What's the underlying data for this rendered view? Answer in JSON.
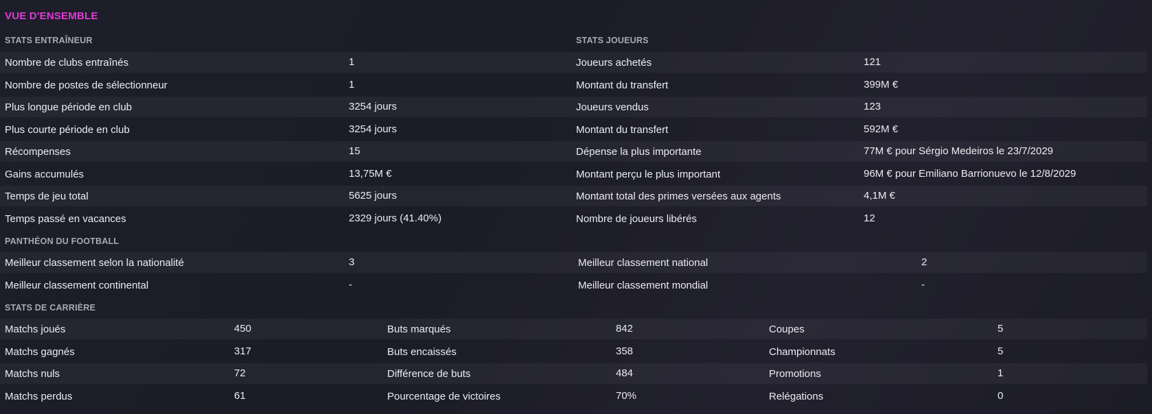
{
  "title": "VUE D'ENSEMBLE",
  "coach_stats": {
    "header": "STATS ENTRAÎNEUR",
    "rows": [
      {
        "label": "Nombre de clubs entraînés",
        "value": "1"
      },
      {
        "label": "Nombre de postes de sélectionneur",
        "value": "1"
      },
      {
        "label": "Plus longue période en club",
        "value": "3254 jours"
      },
      {
        "label": "Plus courte période en club",
        "value": "3254 jours"
      },
      {
        "label": "Récompenses",
        "value": "15"
      },
      {
        "label": "Gains accumulés",
        "value": "13,75M €"
      },
      {
        "label": "Temps de jeu total",
        "value": "5625 jours"
      },
      {
        "label": "Temps passé en vacances",
        "value": "2329 jours (41.40%)"
      }
    ]
  },
  "player_stats": {
    "header": "STATS JOUEURS",
    "rows": [
      {
        "label": "Joueurs achetés",
        "value": "121"
      },
      {
        "label": "Montant du transfert",
        "value": "399M €"
      },
      {
        "label": "Joueurs vendus",
        "value": "123"
      },
      {
        "label": "Montant du transfert",
        "value": "592M €"
      },
      {
        "label": "Dépense la plus importante",
        "value": "77M € pour Sérgio Medeiros le 23/7/2029"
      },
      {
        "label": "Montant perçu le plus important",
        "value": "96M € pour Emiliano Barrionuevo le 12/8/2029"
      },
      {
        "label": "Montant total des primes versées aux agents",
        "value": "4,1M €"
      },
      {
        "label": "Nombre de joueurs libérés",
        "value": "12"
      }
    ]
  },
  "hall_of_fame": {
    "header": "PANTHÉON DU FOOTBALL",
    "rows": [
      {
        "label": "Meilleur classement selon la nationalité",
        "value": "3",
        "label2": "Meilleur classement national",
        "value2": "2"
      },
      {
        "label": "Meilleur classement continental",
        "value": "-",
        "label2": "Meilleur classement mondial",
        "value2": "-"
      }
    ]
  },
  "career_stats": {
    "header": "STATS DE CARRIÈRE",
    "rows": [
      {
        "l1": "Matchs joués",
        "v1": "450",
        "l2": "Buts marqués",
        "v2": "842",
        "l3": "Coupes",
        "v3": "5"
      },
      {
        "l1": "Matchs gagnés",
        "v1": "317",
        "l2": "Buts encaissés",
        "v2": "358",
        "l3": "Championnats",
        "v3": "5"
      },
      {
        "l1": "Matchs nuls",
        "v1": "72",
        "l2": "Différence de buts",
        "v2": "484",
        "l3": "Promotions",
        "v3": "1"
      },
      {
        "l1": "Matchs perdus",
        "v1": "61",
        "l2": "Pourcentage de victoires",
        "v2": "70%",
        "l3": "Relégations",
        "v3": "0"
      }
    ]
  }
}
